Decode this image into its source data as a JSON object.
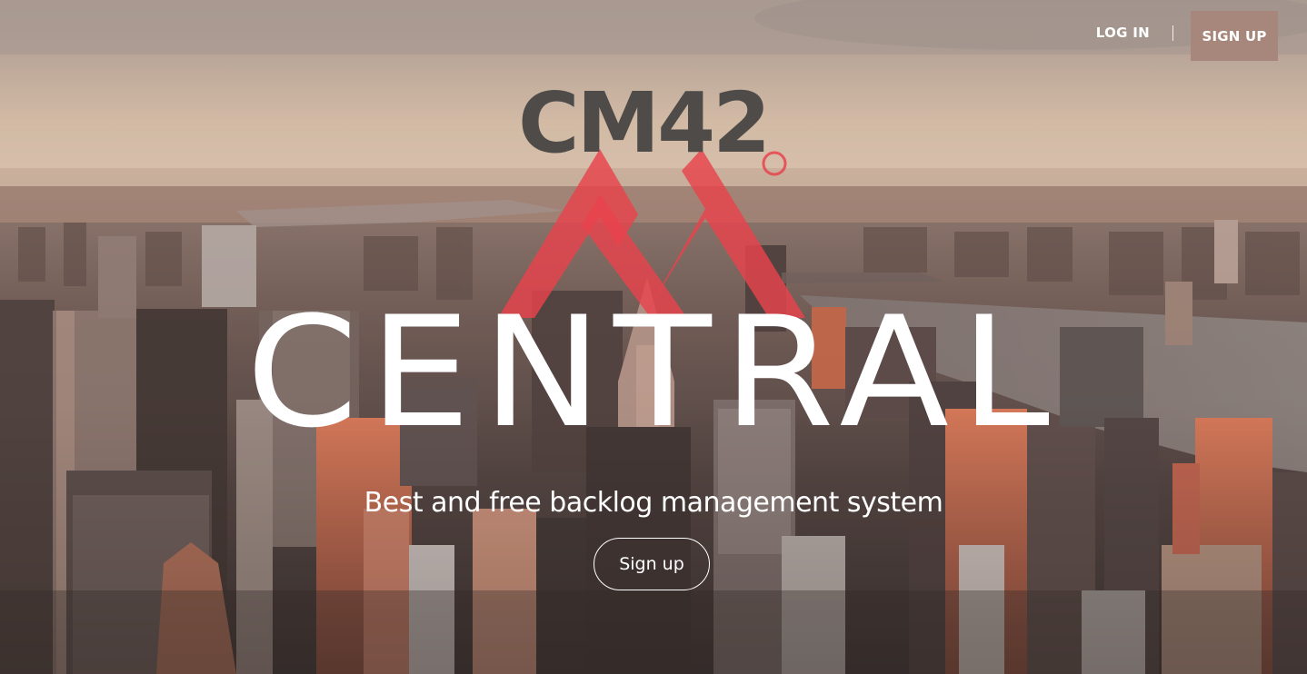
{
  "nav": {
    "login_label": "LOG IN",
    "signup_label": "SIGN UP"
  },
  "logo": {
    "text": "CM42"
  },
  "hero": {
    "title": "CENTRAL",
    "tagline": "Best and free backlog management system",
    "cta_label": "Sign up"
  },
  "colors": {
    "signup_button_bg": "#a7877b",
    "logo_text": "#4f4b49",
    "logo_chevron": "#e8434c",
    "sky": "#c9b4a3"
  },
  "icons": {
    "logo_mark": "mountain-chevron-icon",
    "logo_ring": "circle-icon"
  }
}
